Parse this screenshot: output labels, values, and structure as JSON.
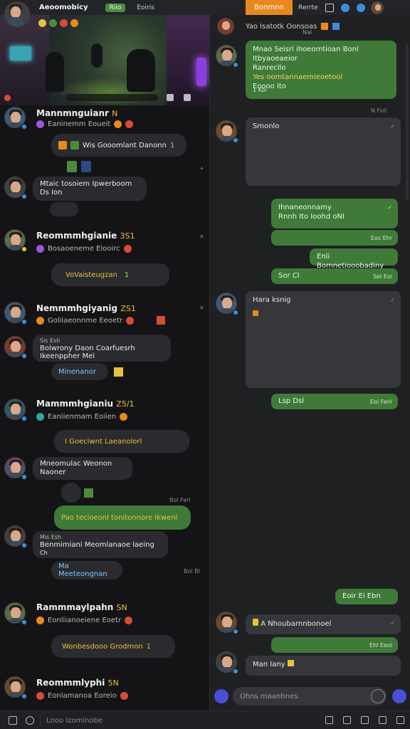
{
  "topbar": {
    "title": "Aeoomobicy",
    "pill_label": "Riio",
    "link_label": "Eoiris",
    "orange_tab": "Bonmnn",
    "right_link": "Rerrte"
  },
  "left_chat": {
    "groups": [
      {
        "head": "Mannmnguianr",
        "ann": "N",
        "sub": "Eaninemm Eoueit",
        "bubble": "Wis Gooomlant Danonn",
        "bubble_tail": "1",
        "bubble2": "",
        "time": ""
      },
      {
        "head": "",
        "ann": "",
        "sub": "",
        "bubble": "Mtaic tosoiem Ipwerboom Ds Ion",
        "bubble_tail": "",
        "bubble2": "Bonoiom",
        "time": ""
      },
      {
        "head": "Reommmhgianie",
        "ann": "3S1",
        "sub": "Bosaoeneme Elooirc",
        "bubble": "VoVaisteugzan",
        "bubble_tail": "1",
        "bubble2": "",
        "time": ""
      },
      {
        "head": "Nemmmhgiyanig",
        "ann": "ZS1",
        "sub": "Goliiaeonnme Eeoetr",
        "bubble": "",
        "bubble_tail": "",
        "bubble2": "",
        "time": ""
      },
      {
        "head": "",
        "ann": "",
        "sub": "",
        "bubble": "Bolwrony Daon Coarfuesrh Ikeenppher Mei",
        "bubble_tail": "",
        "bubble2": "Minenanor",
        "time": ""
      },
      {
        "head": "Mammmhgianiu",
        "ann": "Z5/1",
        "sub": "Eaniienmam Eoiien",
        "bubble": "I Goeciwnt Laeanolorl",
        "bubble_tail": "",
        "bubble2": "",
        "time": ""
      },
      {
        "head": "",
        "ann": "",
        "sub": "",
        "bubble": "Mneomulac Weonon Naoner",
        "bubble_tail": "",
        "bubble2": "",
        "time": "Bol Ferl"
      },
      {
        "head": "",
        "ann": "",
        "sub": "",
        "bubble": "Pao tecioeonl tonitonnore Ikwenl",
        "bubble_tail": "",
        "bubble2": "",
        "time": ""
      },
      {
        "head": "",
        "ann": "",
        "sub": "",
        "bubble": "Benmimiani Meomlanaoe laeing",
        "bubble_tail": "",
        "bubble2": "Ma Meeteongnan",
        "time": "Bol Bl"
      },
      {
        "head": "Rammmaylpahn",
        "ann": "SN",
        "sub": "Eonliianoeiene Eoetr",
        "bubble": "Wonbesdooo Grodmon",
        "bubble_tail": "1",
        "bubble2": "",
        "time": ""
      },
      {
        "head": "Reommmlyphi",
        "ann": "5N",
        "sub": "Eonlamanoa Eoreio",
        "bubble": "",
        "bubble_tail": "",
        "bubble2": "",
        "time": ""
      }
    ],
    "small_text": {
      "g4_line1": "Sis Esh",
      "g8_line0": "Mis Esh",
      "g8_line2": "Ch"
    },
    "footer": {
      "input_placeholder": "Lnoo Izomlnobe"
    }
  },
  "right_panel": {
    "header_text": "Yao Isatotk Oonsoas",
    "header_sub": "Nal",
    "messages": [
      {
        "side": "right",
        "color": "green",
        "lines": [
          "Mnao Seisrl ihoeomtioan Bonl Itbyaoeaeior",
          "Ranrecllo",
          "Yes oomtannaemieoetool",
          "Eoooo Ito"
        ],
        "meta": "1 Kol"
      },
      {
        "side": "left",
        "color": "dark",
        "lines": [
          "Smonlo"
        ],
        "meta": ""
      },
      {
        "side": "right",
        "color": "green",
        "lines": [
          "Ihnaneonnamy",
          "Rnnh Ito Ioohd oNI"
        ],
        "meta": "Eos Ehr"
      },
      {
        "side": "right",
        "color": "green",
        "lines": [
          "Enli Bomnetiooobadiny"
        ],
        "meta": ""
      },
      {
        "side": "right",
        "color": "green",
        "lines": [
          "Sor Cl"
        ],
        "meta": "Sel Eoi"
      },
      {
        "side": "left",
        "color": "dark",
        "lines": [
          "Hara ksnig"
        ],
        "meta": ""
      },
      {
        "side": "right",
        "color": "green",
        "lines": [
          "Lsp Dsl"
        ],
        "meta": "Eol Fenl"
      },
      {
        "side": "right",
        "color": "green",
        "lines": [
          "Eoir Ei Ebn"
        ],
        "meta": "Esl"
      },
      {
        "side": "left",
        "color": "dark",
        "lines": [
          "A Nhoubarnnbonoel"
        ],
        "meta": ""
      },
      {
        "side": "right",
        "color": "green",
        "lines": [
          ""
        ],
        "meta": "Ehl Eeol"
      },
      {
        "side": "left",
        "color": "dark",
        "lines": [
          "Man Iany"
        ],
        "meta": ""
      }
    ],
    "times": [
      "N Foll",
      "Sel Foil"
    ],
    "input_placeholder": "Ohns maanhnes."
  },
  "colors": {
    "accent_green": "#3f7a38",
    "accent_orange": "#e8891f",
    "accent_blue": "#3b8fd9",
    "accent_yellow": "#e8c23a"
  }
}
